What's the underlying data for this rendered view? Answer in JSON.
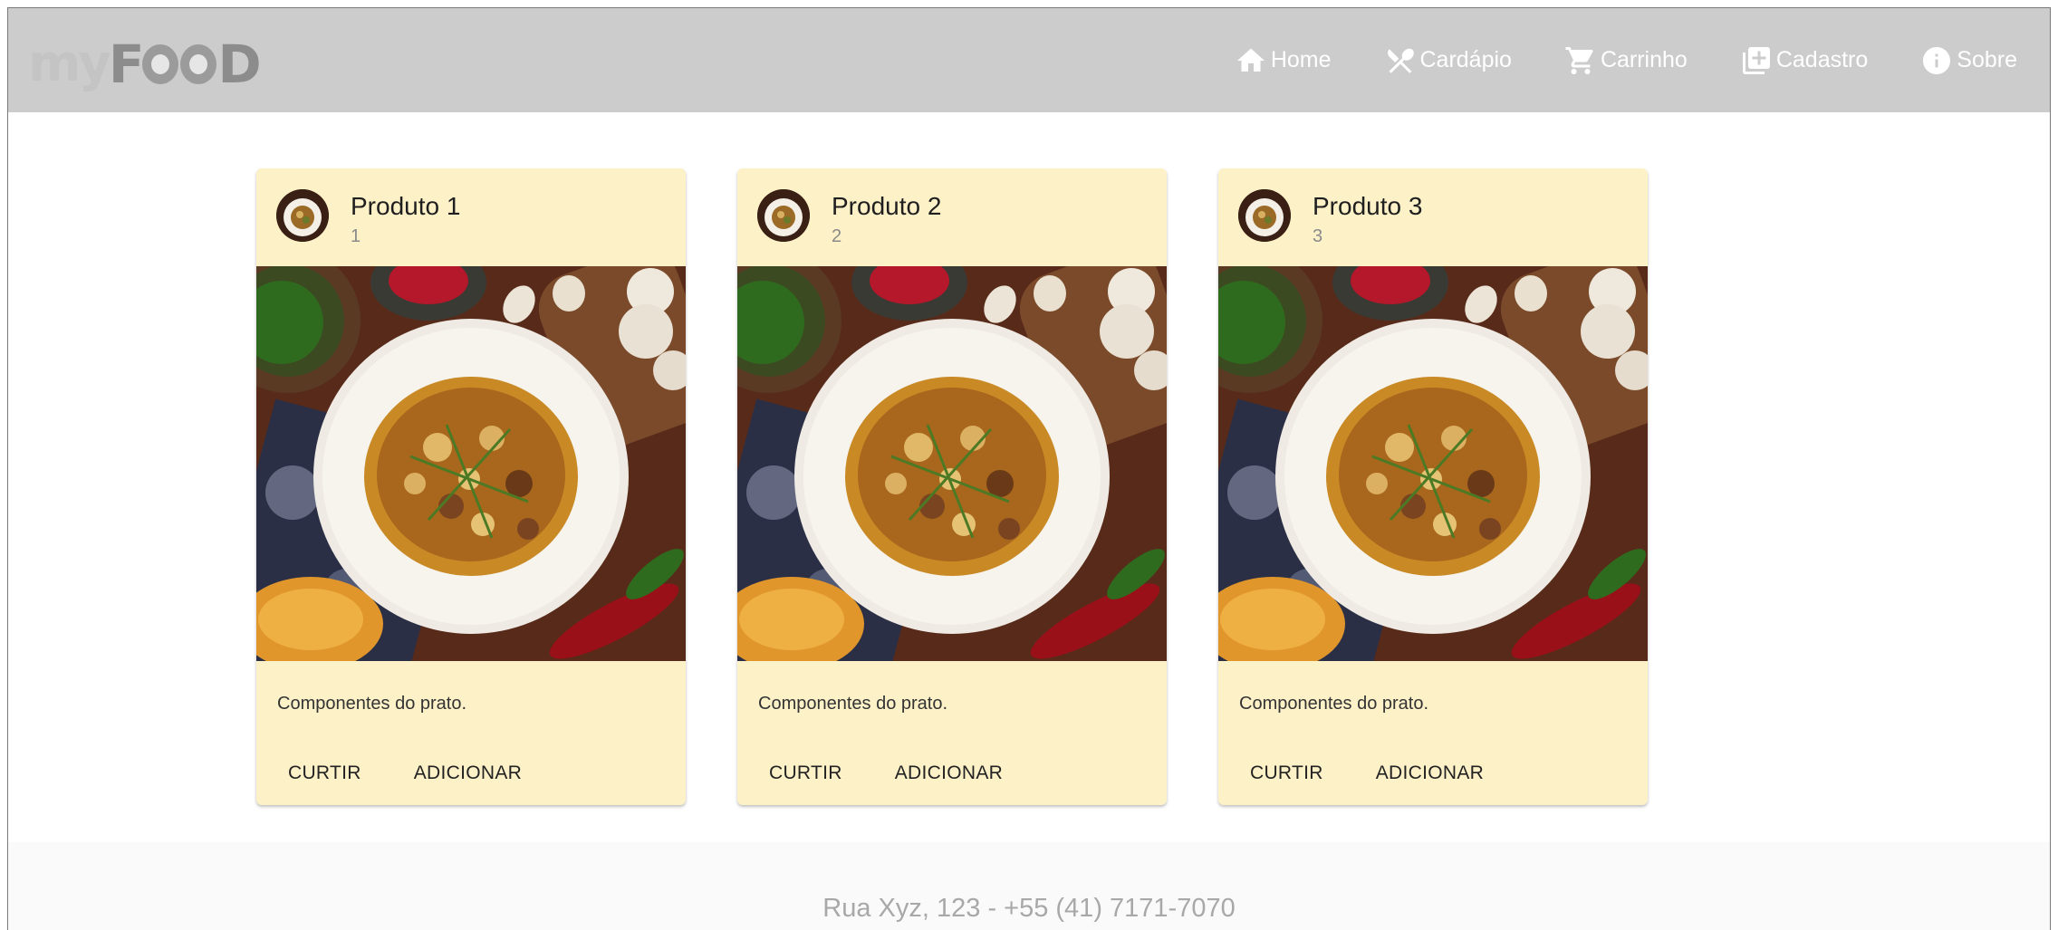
{
  "header": {
    "logo_left": "my",
    "logo_right": "F",
    "logo_right_tail": "D",
    "nav": [
      {
        "label": "Home",
        "icon": "home-icon"
      },
      {
        "label": "Cardápio",
        "icon": "utensils-icon"
      },
      {
        "label": "Carrinho",
        "icon": "cart-icon"
      },
      {
        "label": "Cadastro",
        "icon": "add-box-icon"
      },
      {
        "label": "Sobre",
        "icon": "info-icon"
      }
    ]
  },
  "products": [
    {
      "title": "Produto 1",
      "subtitle": "1",
      "description": "Componentes do prato.",
      "like_label": "CURTIR",
      "add_label": "ADICIONAR"
    },
    {
      "title": "Produto 2",
      "subtitle": "2",
      "description": "Componentes do prato.",
      "like_label": "CURTIR",
      "add_label": "ADICIONAR"
    },
    {
      "title": "Produto 3",
      "subtitle": "3",
      "description": "Componentes do prato.",
      "like_label": "CURTIR",
      "add_label": "ADICIONAR"
    }
  ],
  "footer": {
    "text": "Rua Xyz, 123 - +55 (41) 7171-7070"
  },
  "colors": {
    "header_bg": "#cccccc",
    "card_bg": "#fdf1c8",
    "footer_bg": "#fafafa"
  }
}
